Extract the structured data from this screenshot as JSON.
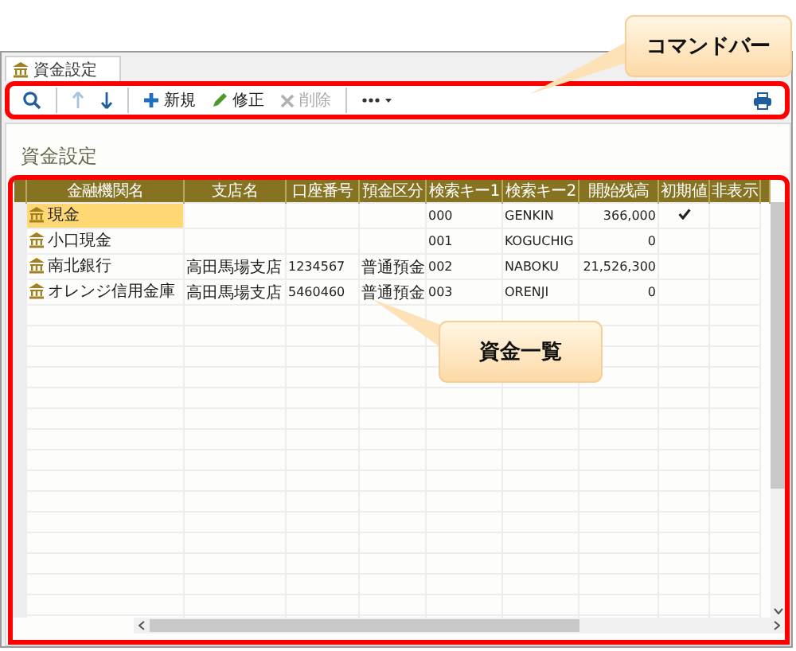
{
  "tabs": [
    {
      "label": "資金設定",
      "selected": true
    }
  ],
  "toolbar": {
    "items": [
      {
        "kind": "search"
      },
      {
        "kind": "separator"
      },
      {
        "kind": "up",
        "disabled": true
      },
      {
        "kind": "down",
        "disabled": false
      },
      {
        "kind": "separator"
      },
      {
        "kind": "add",
        "label": "新規",
        "disabled": false
      },
      {
        "kind": "edit",
        "label": "修正",
        "disabled": false
      },
      {
        "kind": "delete",
        "label": "削除",
        "disabled": true
      },
      {
        "kind": "separator"
      },
      {
        "kind": "more"
      },
      {
        "kind": "print"
      }
    ]
  },
  "page": {
    "title": "資金設定"
  },
  "table": {
    "columns": [
      "金融機関名",
      "支店名",
      "口座番号",
      "預金区分",
      "検索キー1",
      "検索キー2",
      "開始残高",
      "初期値",
      "非表示"
    ],
    "rows": [
      {
        "name": "現金",
        "key_1": "000",
        "key_2": "GENKIN",
        "opening_balance": "366,000",
        "default": true,
        "hidden": false,
        "selected": true
      },
      {
        "name": "小口現金",
        "key_1": "001",
        "key_2": "KOGUCHIG",
        "opening_balance": "0",
        "default": false,
        "hidden": false,
        "selected": false
      },
      {
        "name": "南北銀行",
        "branch": "高田馬場支店",
        "account_number": "1234567",
        "deposit_type": "普通預金",
        "key_1": "002",
        "key_2": "NABOKU",
        "opening_balance": "21,526,300",
        "default": false,
        "hidden": false,
        "selected": false
      },
      {
        "name": "オレンジ信用金庫",
        "branch": "高田馬場支店",
        "account_number": "5460460",
        "deposit_type": "普通預金",
        "key_1": "003",
        "key_2": "ORENJI",
        "opening_balance": "0",
        "default": false,
        "hidden": false,
        "selected": false
      }
    ]
  },
  "callouts": [
    {
      "text": "コマンドバー"
    },
    {
      "text": "資金一覧"
    }
  ]
}
